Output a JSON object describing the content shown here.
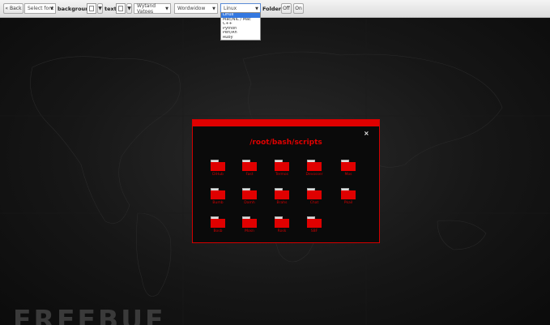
{
  "toolbar": {
    "back_label": "« Back",
    "select_font": "Select font",
    "background_label": "background:",
    "text_label": "text:",
    "wordpress_select": "Wytand Vatoes",
    "theme_select": "Wordwidow",
    "os_select": "Linux",
    "folders_label": "Folders:",
    "off_label": "Off",
    "on_label": "On",
    "bg_color": "#ffffff",
    "text_color": "#ffffff"
  },
  "os_dropdown": {
    "options": [
      "Linux",
      "Mac/NIL / Mac",
      "C++",
      "Python",
      "Perl/Ah",
      "Ruby"
    ],
    "selected_index": 0
  },
  "dialog": {
    "path": "/root/bash/scripts",
    "close_symbol": "×",
    "folders": [
      {
        "name": "DiHub"
      },
      {
        "name": "Fast"
      },
      {
        "name": "Termos"
      },
      {
        "name": "Devosser"
      },
      {
        "name": "Mos"
      },
      {
        "name": "Bumb"
      },
      {
        "name": "Damh"
      },
      {
        "name": "Brahs"
      },
      {
        "name": "Chat"
      },
      {
        "name": "Pkail"
      },
      {
        "name": "Bosb"
      },
      {
        "name": "Mosn"
      },
      {
        "name": "Rosk"
      },
      {
        "name": "SBF"
      }
    ]
  },
  "watermark": "FREEBUF",
  "colors": {
    "accent": "#e00000",
    "dialog_bg": "#0a0a0a",
    "toolbar_bg": "#e6e6e6"
  },
  "icons": {
    "folder": "folder-icon",
    "close": "close-icon",
    "dropdown": "chevron-down-icon"
  }
}
